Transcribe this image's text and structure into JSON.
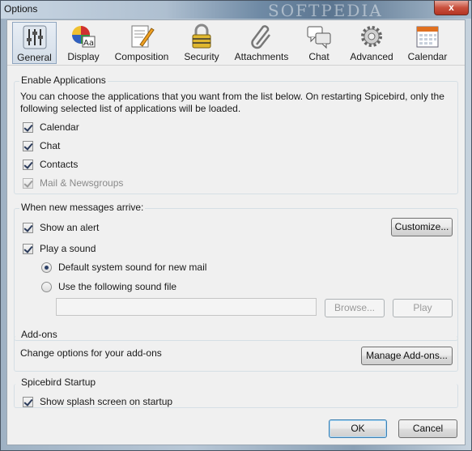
{
  "window": {
    "title": "Options",
    "close_label": "x",
    "watermark": "SOFTPEDIA"
  },
  "toolbar": {
    "items": [
      {
        "label": "General",
        "icon": "sliders-icon"
      },
      {
        "label": "Display",
        "icon": "color-font-icon"
      },
      {
        "label": "Composition",
        "icon": "pencil-paper-icon"
      },
      {
        "label": "Security",
        "icon": "padlock-icon"
      },
      {
        "label": "Attachments",
        "icon": "paperclip-icon"
      },
      {
        "label": "Chat",
        "icon": "chat-bubbles-icon"
      },
      {
        "label": "Advanced",
        "icon": "gear-icon"
      },
      {
        "label": "Calendar",
        "icon": "calendar-icon"
      }
    ],
    "selected": "General"
  },
  "enable_apps": {
    "title": "Enable Applications",
    "description": "You can choose the applications that you want from the list below. On restarting Spicebird, only the following selected list of applications will be loaded.",
    "items": [
      {
        "label": "Calendar",
        "checked": true
      },
      {
        "label": "Chat",
        "checked": true
      },
      {
        "label": "Contacts",
        "checked": true
      },
      {
        "label": "Mail & Newsgroups",
        "checked": true,
        "disabled": true
      }
    ]
  },
  "new_messages": {
    "title": "When new messages arrive:",
    "show_alert": "Show an alert",
    "customize": "Customize...",
    "play_sound": "Play a sound",
    "default_sound": "Default system sound for new mail",
    "use_sound_file": "Use the following sound file",
    "sound_file_value": "",
    "browse": "Browse...",
    "play": "Play"
  },
  "addons": {
    "title": "Add-ons",
    "description": "Change options for your add-ons",
    "manage": "Manage Add-ons..."
  },
  "startup": {
    "title": "Spicebird Startup",
    "splash": "Show splash screen on startup"
  },
  "footer": {
    "ok": "OK",
    "cancel": "Cancel"
  }
}
